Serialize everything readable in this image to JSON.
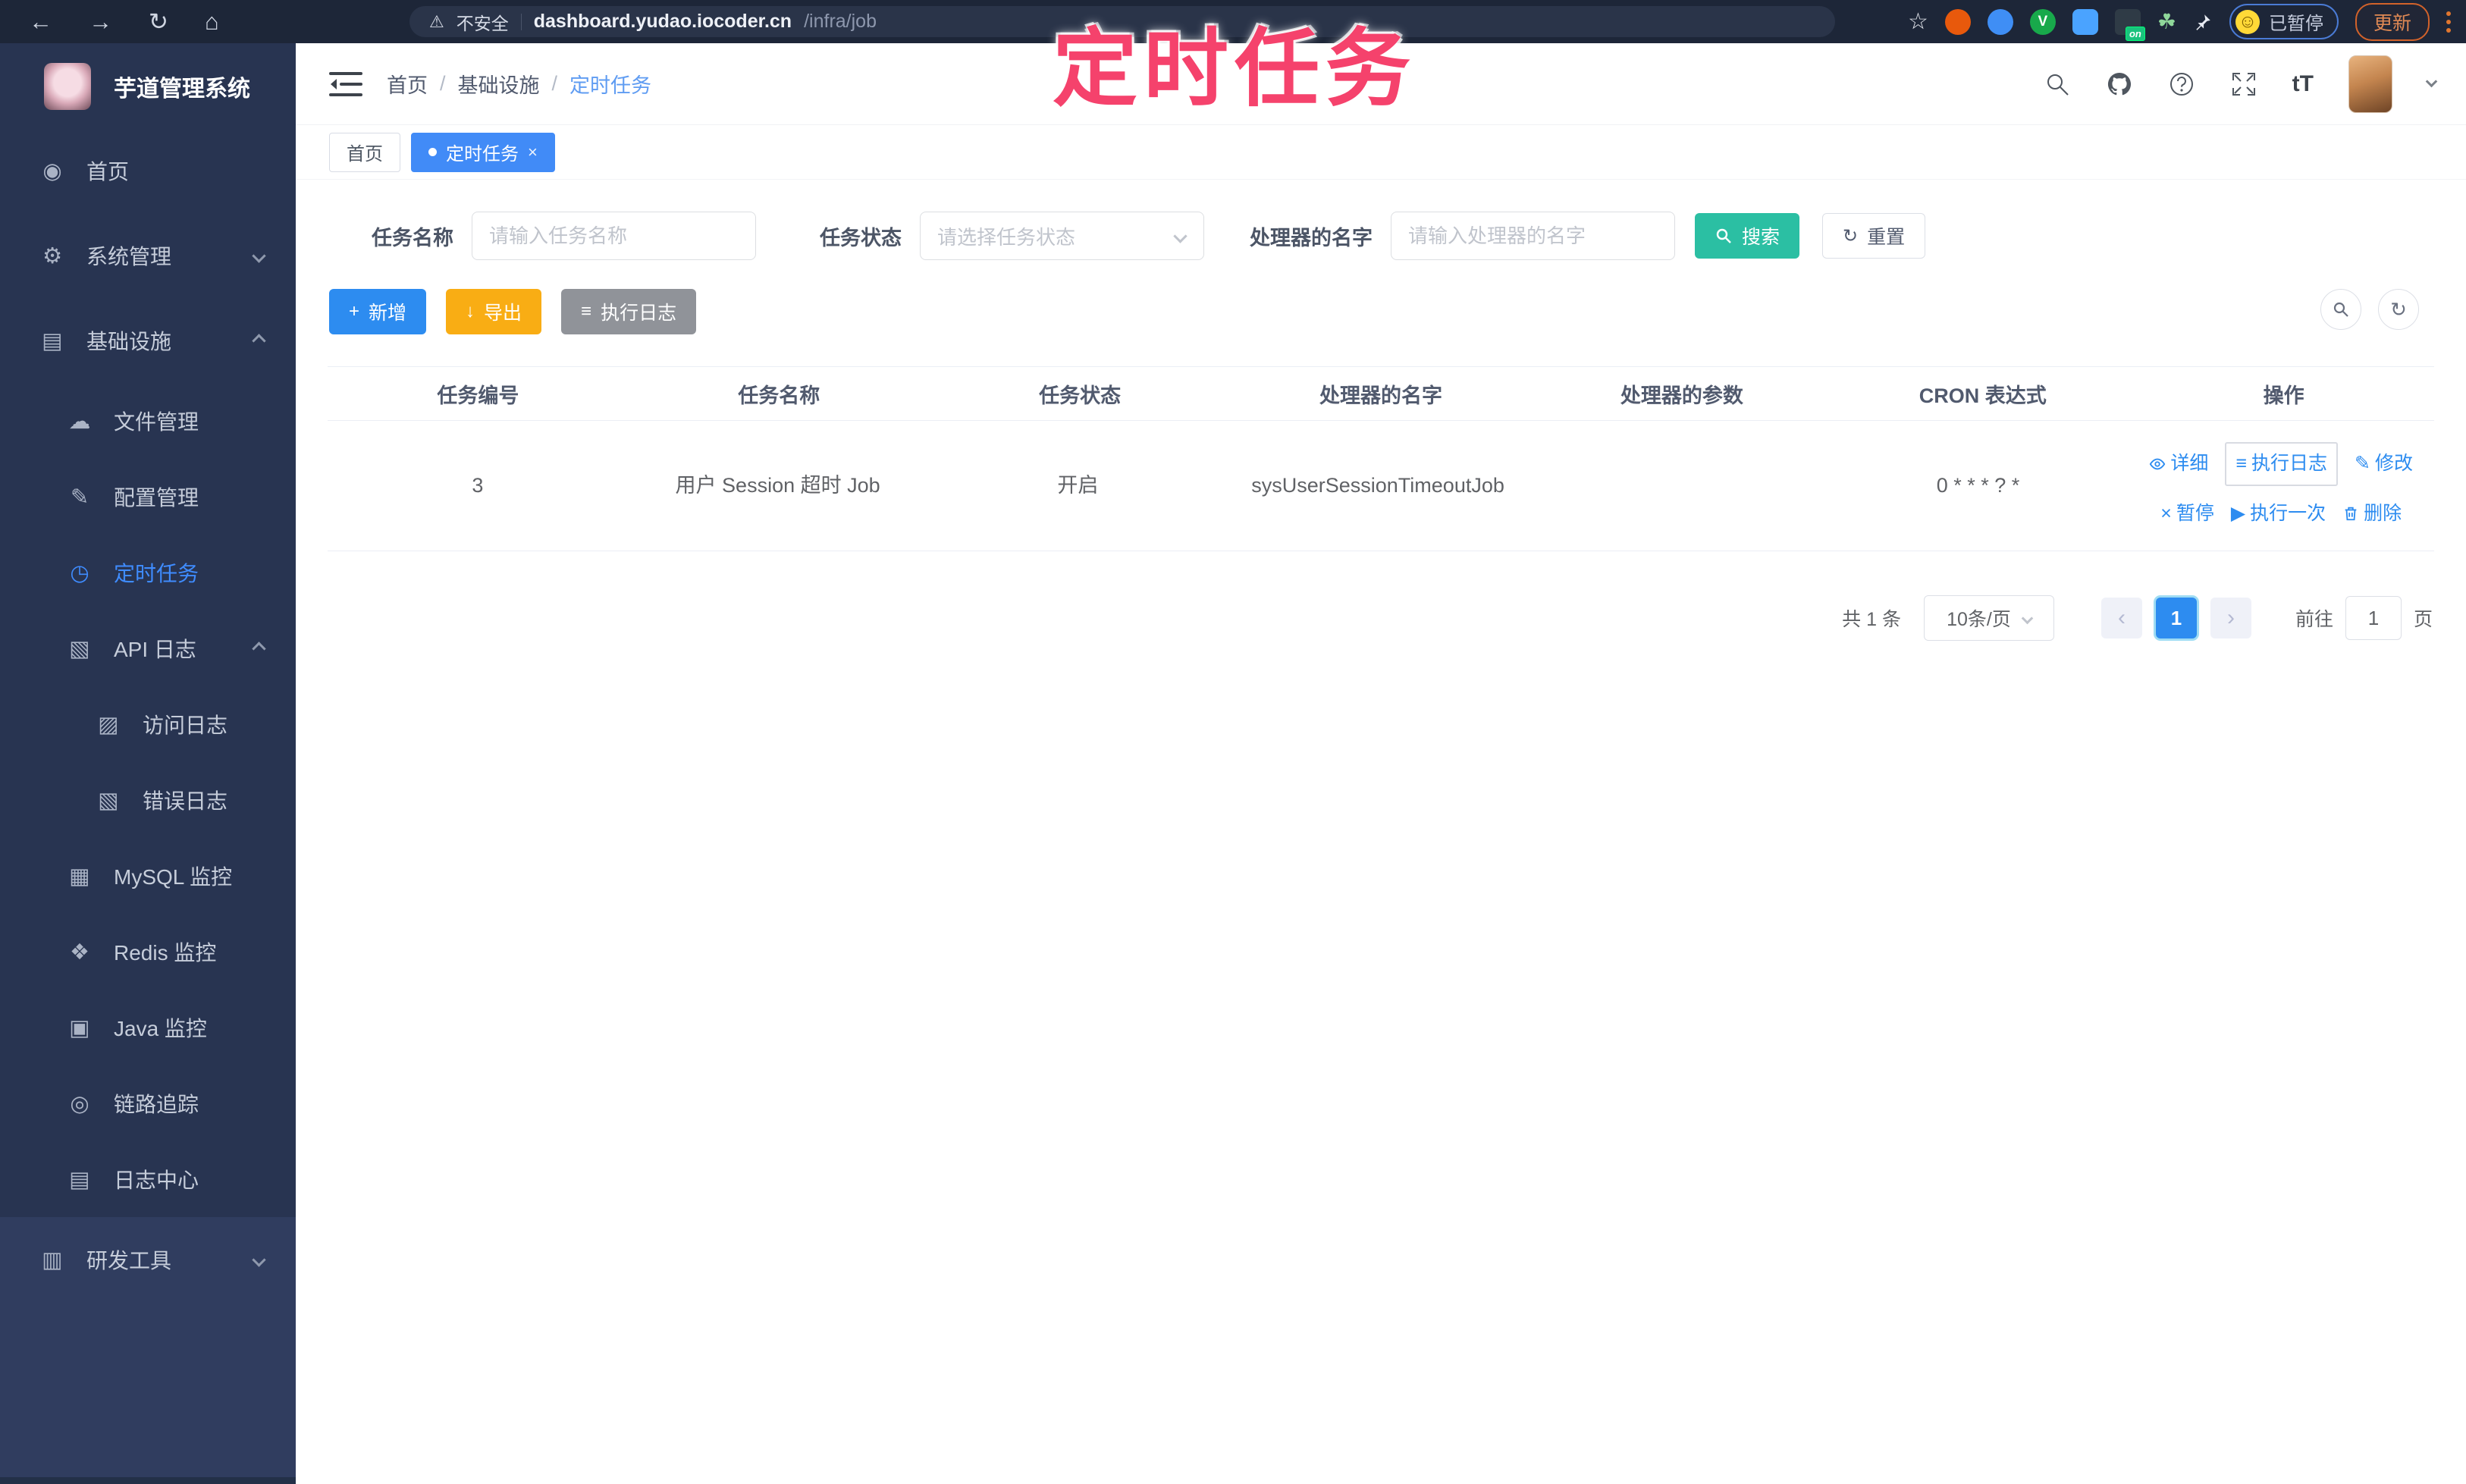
{
  "browser": {
    "security_label": "不安全",
    "url_host": "dashboard.yudao.iocoder.cn",
    "url_path": "/infra/job",
    "paused_label": "已暂停",
    "update_label": "更新",
    "on_badge": "on",
    "v_logo": "V"
  },
  "annotation": {
    "text": "定时任务"
  },
  "icons": {
    "back": "←",
    "forward": "→",
    "reload": "↻",
    "home": "⌂",
    "warning": "⚠",
    "star": "☆",
    "leaf": "☘",
    "face": "☺",
    "font_size": "tT",
    "close": "×",
    "plus": "+",
    "download": "↓",
    "list": "≡",
    "refresh": "↻",
    "prev": "‹",
    "next": "›",
    "op_edit": "✎",
    "op_pause": "×",
    "op_run": "▶"
  },
  "sidebar": {
    "app_title": "芋道管理系统",
    "items": [
      {
        "label": "首页",
        "icon": "◉"
      },
      {
        "label": "系统管理",
        "icon": "⚙"
      },
      {
        "label": "基础设施",
        "icon": "▤"
      },
      {
        "label": "文件管理",
        "icon": "☁"
      },
      {
        "label": "配置管理",
        "icon": "✎"
      },
      {
        "label": "定时任务",
        "icon": "◷"
      },
      {
        "label": "API 日志",
        "icon": "▧"
      },
      {
        "label": "访问日志",
        "icon": "▨"
      },
      {
        "label": "错误日志",
        "icon": "▧"
      },
      {
        "label": "MySQL 监控",
        "icon": "▦"
      },
      {
        "label": "Redis 监控",
        "icon": "❖"
      },
      {
        "label": "Java 监控",
        "icon": "▣"
      },
      {
        "label": "链路追踪",
        "icon": "◎"
      },
      {
        "label": "日志中心",
        "icon": "▤"
      },
      {
        "label": "研发工具",
        "icon": "▥"
      }
    ]
  },
  "breadcrumb": {
    "items": [
      "首页",
      "基础设施",
      "定时任务"
    ],
    "separator": "/"
  },
  "tabs": [
    {
      "label": "首页"
    },
    {
      "label": "定时任务"
    }
  ],
  "filters": {
    "task_name": {
      "label": "任务名称",
      "placeholder": "请输入任务名称"
    },
    "task_status": {
      "label": "任务状态",
      "placeholder": "请选择任务状态"
    },
    "handler_name": {
      "label": "处理器的名字",
      "placeholder": "请输入处理器的名字"
    },
    "search_label": "搜索",
    "reset_label": "重置"
  },
  "toolbar": {
    "add_label": "新增",
    "export_label": "导出",
    "exec_log_label": "执行日志"
  },
  "table": {
    "columns": [
      "任务编号",
      "任务名称",
      "任务状态",
      "处理器的名字",
      "处理器的参数",
      "CRON 表达式",
      "操作"
    ],
    "rows": [
      {
        "id": "3",
        "name": "用户 Session 超时 Job",
        "status": "开启",
        "handler": "sysUserSessionTimeoutJob",
        "params": "",
        "cron": "0 * * * ? *"
      }
    ]
  },
  "ops": [
    "详细",
    "执行日志",
    "修改",
    "暂停",
    "执行一次",
    "删除"
  ],
  "pagination": {
    "total_label": "共 1 条",
    "page_size_label": "10条/页",
    "current_page": "1",
    "goto_label": "前往",
    "goto_value": "1",
    "page_unit": "页"
  },
  "colors": {
    "accent_blue": "#2d8cf0",
    "active_tab_blue": "#418bf7",
    "search_teal": "#2bbfa3",
    "export_orange": "#f9ad14",
    "info_gray": "#909399",
    "sidebar_navy": "#283451",
    "chrome_navy": "#1d2638",
    "annotation_pink": "#f5426c"
  }
}
